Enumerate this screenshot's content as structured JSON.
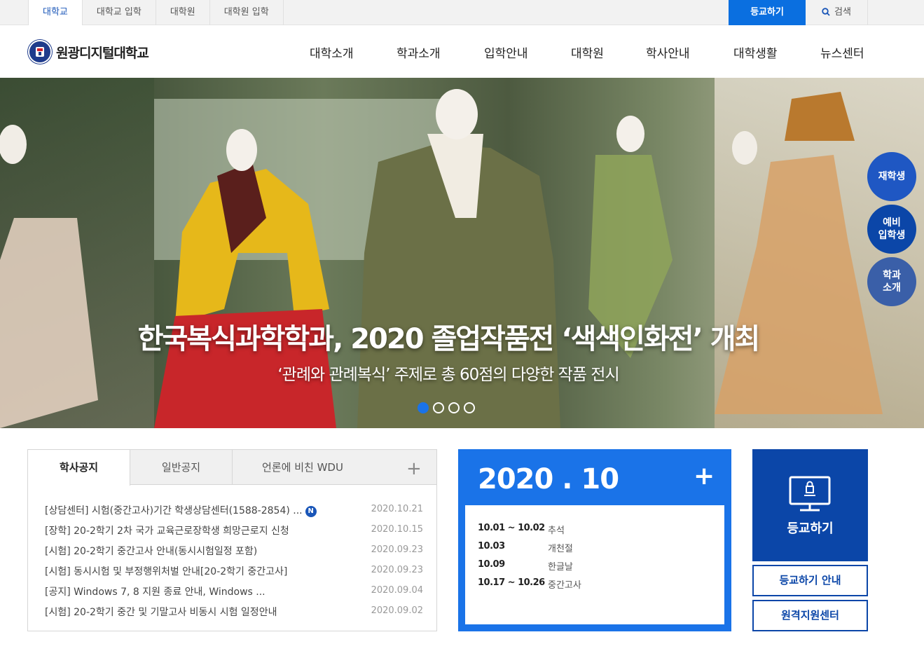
{
  "top_tabs": [
    {
      "label": "대학교"
    },
    {
      "label": "대학교 입학"
    },
    {
      "label": "대학원"
    },
    {
      "label": "대학원 입학"
    }
  ],
  "top_actions": {
    "login": "등교하기",
    "search": "검색"
  },
  "logo": {
    "text": "원광디지털대학교"
  },
  "gnb": [
    {
      "label": "대학소개"
    },
    {
      "label": "학과소개"
    },
    {
      "label": "입학안내"
    },
    {
      "label": "대학원"
    },
    {
      "label": "학사안내"
    },
    {
      "label": "대학생활"
    },
    {
      "label": "뉴스센터"
    }
  ],
  "hero": {
    "title": "한국복식과학학과, 2020 졸업작품전 ‘색색인화전’ 개최",
    "subtitle": "‘관례와 관례복식’ 주제로 총 60점의 다양한 작품 전시",
    "slide_count": 4,
    "active_slide": 1
  },
  "quick_links": [
    {
      "label": "재학생",
      "color": "#1f57c3"
    },
    {
      "label": "예비\n입학생",
      "color": "#0b46a8"
    },
    {
      "label": "학과\n소개",
      "color": "#3a5fa8"
    }
  ],
  "notice": {
    "tabs": [
      {
        "label": "학사공지"
      },
      {
        "label": "일반공지"
      },
      {
        "label": "언론에 비친 WDU"
      }
    ],
    "more": "+",
    "new_badge": "N",
    "items": [
      {
        "title": "[상담센터] 시험(중간고사)기간 학생상담센터(1588-2854) ...",
        "date": "2020.10.21",
        "is_new": true
      },
      {
        "title": "[장학] 20-2학기 2차 국가 교육근로장학생 희망근로지 신청",
        "date": "2020.10.15",
        "is_new": false
      },
      {
        "title": "[시험] 20-2학기 중간고사 안내(동시시험일정 포함)",
        "date": "2020.09.23",
        "is_new": false
      },
      {
        "title": "[시험] 동시시험 및 부정행위처벌 안내[20-2학기 중간고사]",
        "date": "2020.09.23",
        "is_new": false
      },
      {
        "title": "[공지] Windows 7, 8 지원 종료 안내, Windows ...",
        "date": "2020.09.04",
        "is_new": false
      },
      {
        "title": "[시험] 20-2학기 중간 및 기말고사 비동시 시험 일정안내",
        "date": "2020.09.02",
        "is_new": false
      }
    ]
  },
  "calendar": {
    "title": "2020 . 10",
    "more": "+",
    "events": [
      {
        "date": "10.01 ~ 10.02",
        "event": "추석"
      },
      {
        "date": "10.03",
        "event": "개천절"
      },
      {
        "date": "10.09",
        "event": "한글날"
      },
      {
        "date": "10.17 ~ 10.26",
        "event": "중간고사"
      }
    ]
  },
  "attend_box": {
    "label": "등교하기",
    "icon": "monitor-icon"
  },
  "outline_buttons": [
    {
      "label": "등교하기 안내"
    },
    {
      "label": "원격지원센터"
    }
  ],
  "colors": {
    "primary": "#0b46a8",
    "accent": "#1a73e8",
    "top_login": "#0a6fe0"
  }
}
